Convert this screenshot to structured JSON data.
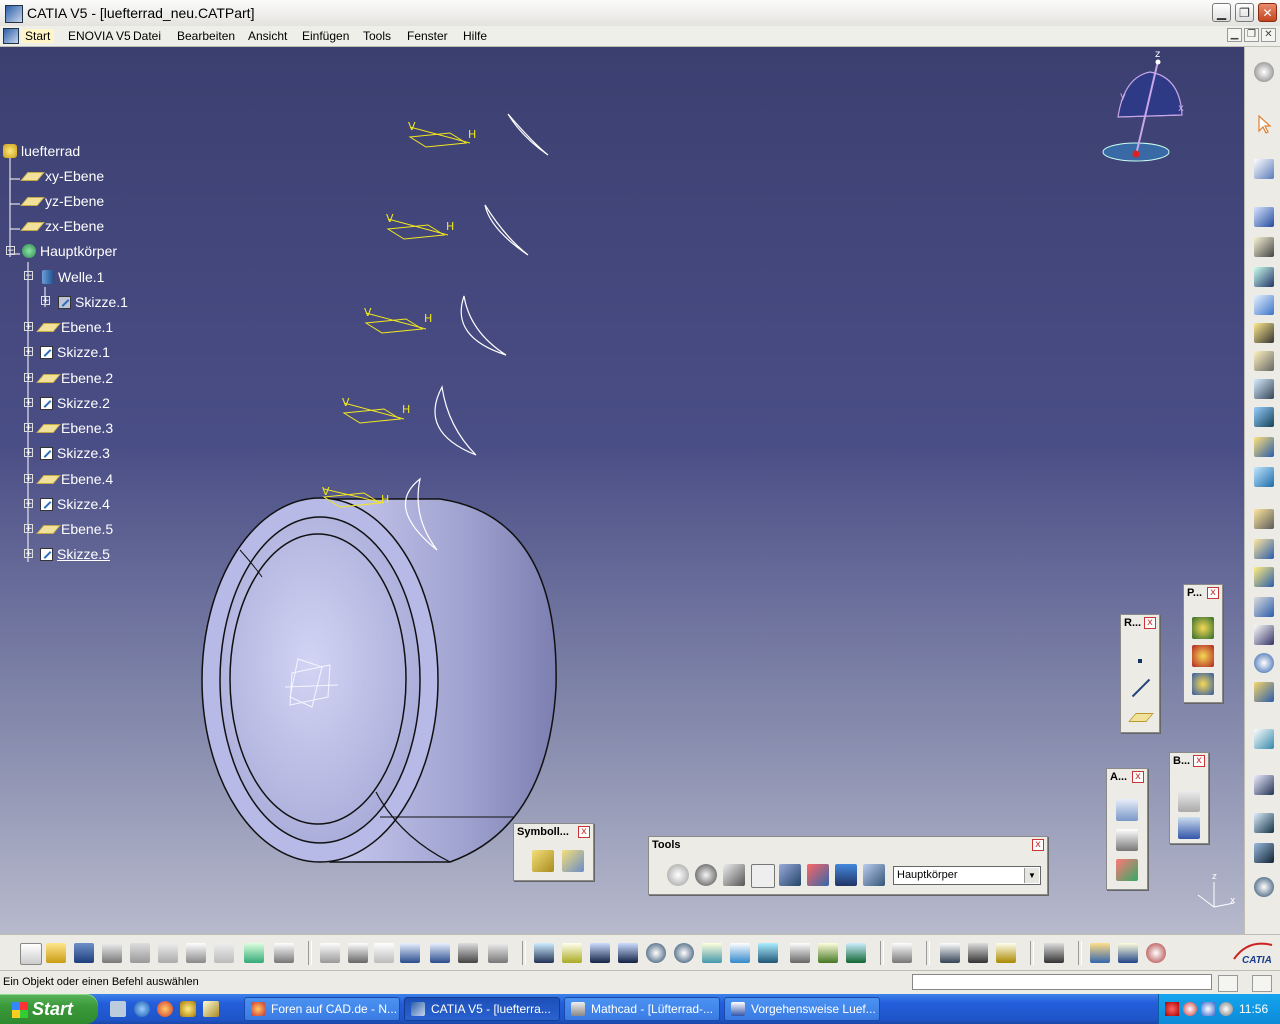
{
  "window": {
    "title": "CATIA V5 - [luefterrad_neu.CATPart]",
    "buttons": {
      "minimize": "▁",
      "maximize": "❐",
      "close": "✕"
    }
  },
  "menu": {
    "items": [
      "Start",
      "ENOVIA V5",
      "Datei",
      "Bearbeiten",
      "Ansicht",
      "Einfügen",
      "Tools",
      "Fenster",
      "Hilfe"
    ]
  },
  "tree": {
    "root": "luefterrad",
    "items": [
      {
        "label": "xy-Ebene",
        "icon": "plane-icon"
      },
      {
        "label": "yz-Ebene",
        "icon": "plane-icon"
      },
      {
        "label": "zx-Ebene",
        "icon": "plane-icon"
      },
      {
        "label": "Hauptkörper",
        "icon": "body-icon"
      },
      {
        "label": "Welle.1",
        "icon": "shaft-icon"
      },
      {
        "label": "Skizze.1",
        "icon": "sketch-icon"
      },
      {
        "label": "Ebene.1",
        "icon": "plane-icon"
      },
      {
        "label": "Skizze.1",
        "icon": "sketch-icon"
      },
      {
        "label": "Ebene.2",
        "icon": "plane-icon"
      },
      {
        "label": "Skizze.2",
        "icon": "sketch-icon"
      },
      {
        "label": "Ebene.3",
        "icon": "plane-icon"
      },
      {
        "label": "Skizze.3",
        "icon": "sketch-icon"
      },
      {
        "label": "Ebene.4",
        "icon": "plane-icon"
      },
      {
        "label": "Skizze.4",
        "icon": "sketch-icon"
      },
      {
        "label": "Ebene.5",
        "icon": "plane-icon"
      },
      {
        "label": "Skizze.5",
        "icon": "sketch-icon"
      }
    ]
  },
  "viewport": {
    "sketch_label_v": "V",
    "sketch_label_h": "H",
    "axis_z": "z",
    "axis_y": "y",
    "axis_x": "x",
    "colors": {
      "background_top": "#3b3f70",
      "background_bottom": "#b7bacc",
      "part": "#c4c6ec",
      "sketch_axis": "#f2e81e"
    }
  },
  "palettes": {
    "symbol": {
      "title": "Symboll...",
      "close": "x"
    },
    "tools": {
      "title": "Tools",
      "close": "x",
      "body_select": "Hauptkörper"
    },
    "r": {
      "title": "R...",
      "close": "x"
    },
    "p": {
      "title": "P...",
      "close": "x"
    },
    "a": {
      "title": "A...",
      "close": "x"
    },
    "b": {
      "title": "B...",
      "close": "x"
    }
  },
  "status": {
    "message": "Ein Objekt oder einen Befehl auswählen"
  },
  "brand": {
    "logo_text": "CATIA"
  },
  "taskbar": {
    "start": "Start",
    "tasks": [
      {
        "label": "Foren auf CAD.de - N...",
        "active": false
      },
      {
        "label": "CATIA V5 - [luefterra...",
        "active": true
      },
      {
        "label": "Mathcad - [Lüfterrad-...",
        "active": false
      },
      {
        "label": "Vorgehensweise Luef...",
        "active": false
      }
    ],
    "clock": "11:56"
  }
}
